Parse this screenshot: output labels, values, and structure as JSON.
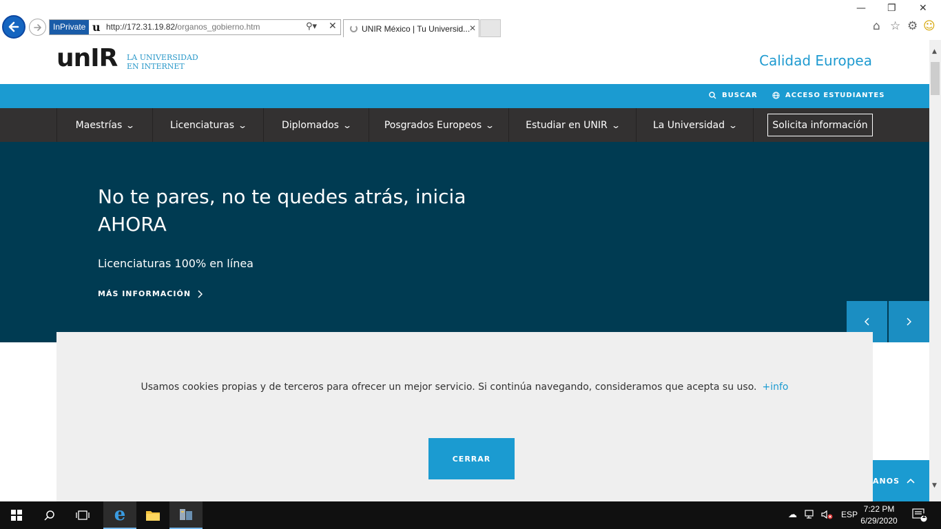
{
  "browser": {
    "inprivate": "InPrivate",
    "url_host": "http://172.31.19.82/",
    "url_path": "organos_gobierno.htm",
    "tab_title": "UNIR México | Tu Universid...",
    "tab_close": "✕"
  },
  "header": {
    "logo": "unIR",
    "tagline_1": "LA UNIVERSIDAD",
    "tagline_2": "EN INTERNET",
    "calidad": "Calidad Europea"
  },
  "topbar": {
    "buscar": "BUSCAR",
    "acceso": "ACCESO ESTUDIANTES"
  },
  "nav": {
    "items": [
      {
        "label": "Maestrías"
      },
      {
        "label": "Licenciaturas"
      },
      {
        "label": "Diplomados"
      },
      {
        "label": "Posgrados Europeos"
      },
      {
        "label": "Estudiar en UNIR"
      },
      {
        "label": "La Universidad"
      }
    ],
    "cta": "Solicita información"
  },
  "hero": {
    "title": "No te pares, no te quedes atrás, inicia AHORA",
    "subtitle": "Licenciaturas 100% en línea",
    "more": "MÁS INFORMACIÓN"
  },
  "cookie": {
    "text": "Usamos cookies propias y de terceros para ofrecer un mejor servicio. Si continúa navegando, consideramos que acepta su uso.",
    "info_link": "+info",
    "close": "CERRAR"
  },
  "floating": {
    "label": "ANOS"
  },
  "taskbar": {
    "lang": "ESP",
    "time": "7:22 PM",
    "date": "6/29/2020",
    "notif_count": "1"
  },
  "colors": {
    "brand_blue": "#1b9bd1",
    "hero_bg": "#003b52",
    "nav_bg": "#333131"
  }
}
